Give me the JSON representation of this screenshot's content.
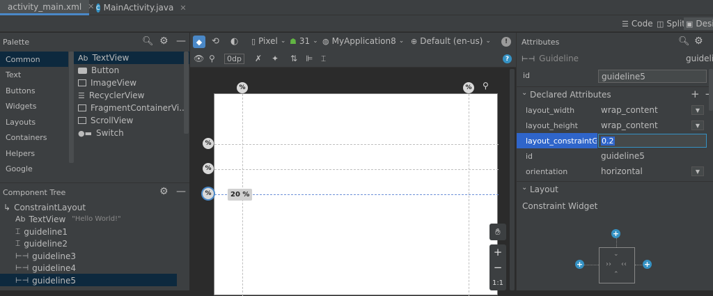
{
  "tabs": [
    {
      "label": "activity_main.xml"
    },
    {
      "label": "MainActivity.java"
    }
  ],
  "view_modes": {
    "code": "Code",
    "split": "Split",
    "design": "Design"
  },
  "palette": {
    "title": "Palette",
    "categories": [
      "Common",
      "Text",
      "Buttons",
      "Widgets",
      "Layouts",
      "Containers",
      "Helpers",
      "Google"
    ],
    "items": [
      "TextView",
      "Button",
      "ImageView",
      "RecyclerView",
      "FragmentContainerVi...",
      "ScrollView",
      "Switch"
    ],
    "textview_prefix": "Ab"
  },
  "toolbar": {
    "device": "Pixel",
    "api": "31",
    "app": "MyApplication8",
    "locale": "Default (en-us)",
    "margin": "0dp"
  },
  "component_tree": {
    "title": "Component Tree",
    "root": "ConstraintLayout",
    "textview_prefix": "Ab",
    "textview": "TextView",
    "textview_text": "\"Hello World!\"",
    "guidelines": [
      "guideline1",
      "guideline2",
      "guideline3",
      "guideline4",
      "guideline5"
    ]
  },
  "canvas": {
    "pct_symbol": "%",
    "guide_label": "20 %",
    "zoom_plus": "+",
    "zoom_minus": "−",
    "zoom_ratio": "1:1"
  },
  "attributes": {
    "title": "Attributes",
    "component": "Guideline",
    "component_id_short": "guidelin",
    "id_label": "id",
    "id_value": "guideline5",
    "declared_title": "Declared Attributes",
    "rows": [
      {
        "label": "layout_width",
        "value": "wrap_content"
      },
      {
        "label": "layout_height",
        "value": "wrap_content"
      },
      {
        "label": "layout_constraintGui...",
        "value": "0.2"
      },
      {
        "label": "id",
        "value": "guideline5"
      },
      {
        "label": "orientation",
        "value": "horizontal"
      }
    ],
    "layout_title": "Layout",
    "constraint_widget": "Constraint Widget"
  },
  "colors": {
    "accent": "#4a88c7",
    "selection": "#0d293e",
    "field_sel": "#2f65ca",
    "guideline": "#6a8fd8"
  }
}
